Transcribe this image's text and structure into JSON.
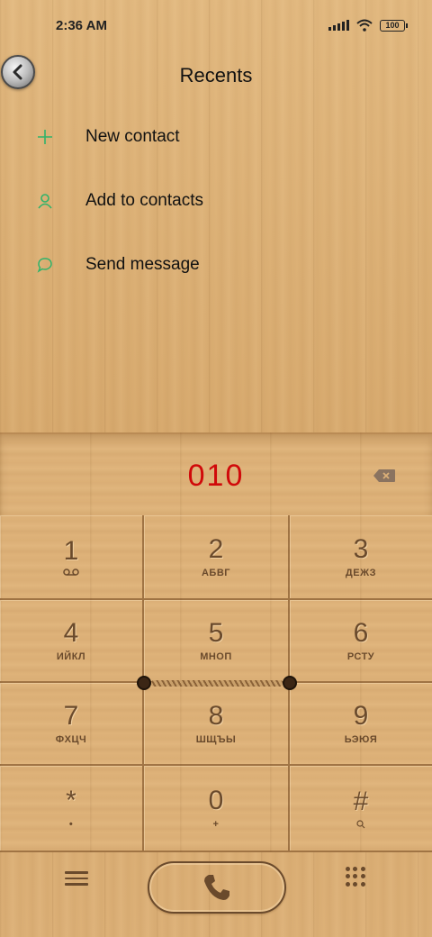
{
  "status_bar": {
    "time": "2:36 AM",
    "battery": "100",
    "icons": [
      "signal-icon",
      "wifi-icon",
      "battery-icon"
    ]
  },
  "header": {
    "title": "Recents",
    "back_icon": "chevron-left-icon"
  },
  "menu": {
    "items": [
      {
        "label": "New contact",
        "icon": "plus-icon"
      },
      {
        "label": "Add to contacts",
        "icon": "person-icon"
      },
      {
        "label": "Send message",
        "icon": "message-icon"
      }
    ]
  },
  "dialer": {
    "number": "010",
    "number_color": "#d0090a"
  },
  "keypad": {
    "keys": [
      {
        "digit": "1",
        "letters": ""
      },
      {
        "digit": "2",
        "letters": "АБВГ"
      },
      {
        "digit": "3",
        "letters": "ДЕЖЗ"
      },
      {
        "digit": "4",
        "letters": "ИЙКЛ"
      },
      {
        "digit": "5",
        "letters": "МНОП"
      },
      {
        "digit": "6",
        "letters": "РСТУ"
      },
      {
        "digit": "7",
        "letters": "ФХЦЧ"
      },
      {
        "digit": "8",
        "letters": "ШЩЪЫ"
      },
      {
        "digit": "9",
        "letters": "ЬЭЮЯ"
      },
      {
        "digit": "*",
        "letters": "•"
      },
      {
        "digit": "0",
        "letters": "+"
      },
      {
        "digit": "#",
        "letters": ""
      }
    ]
  },
  "colors": {
    "accent_green": "#2fb36a",
    "wood": "#dcb078",
    "engraving": "#6a4a2c"
  }
}
